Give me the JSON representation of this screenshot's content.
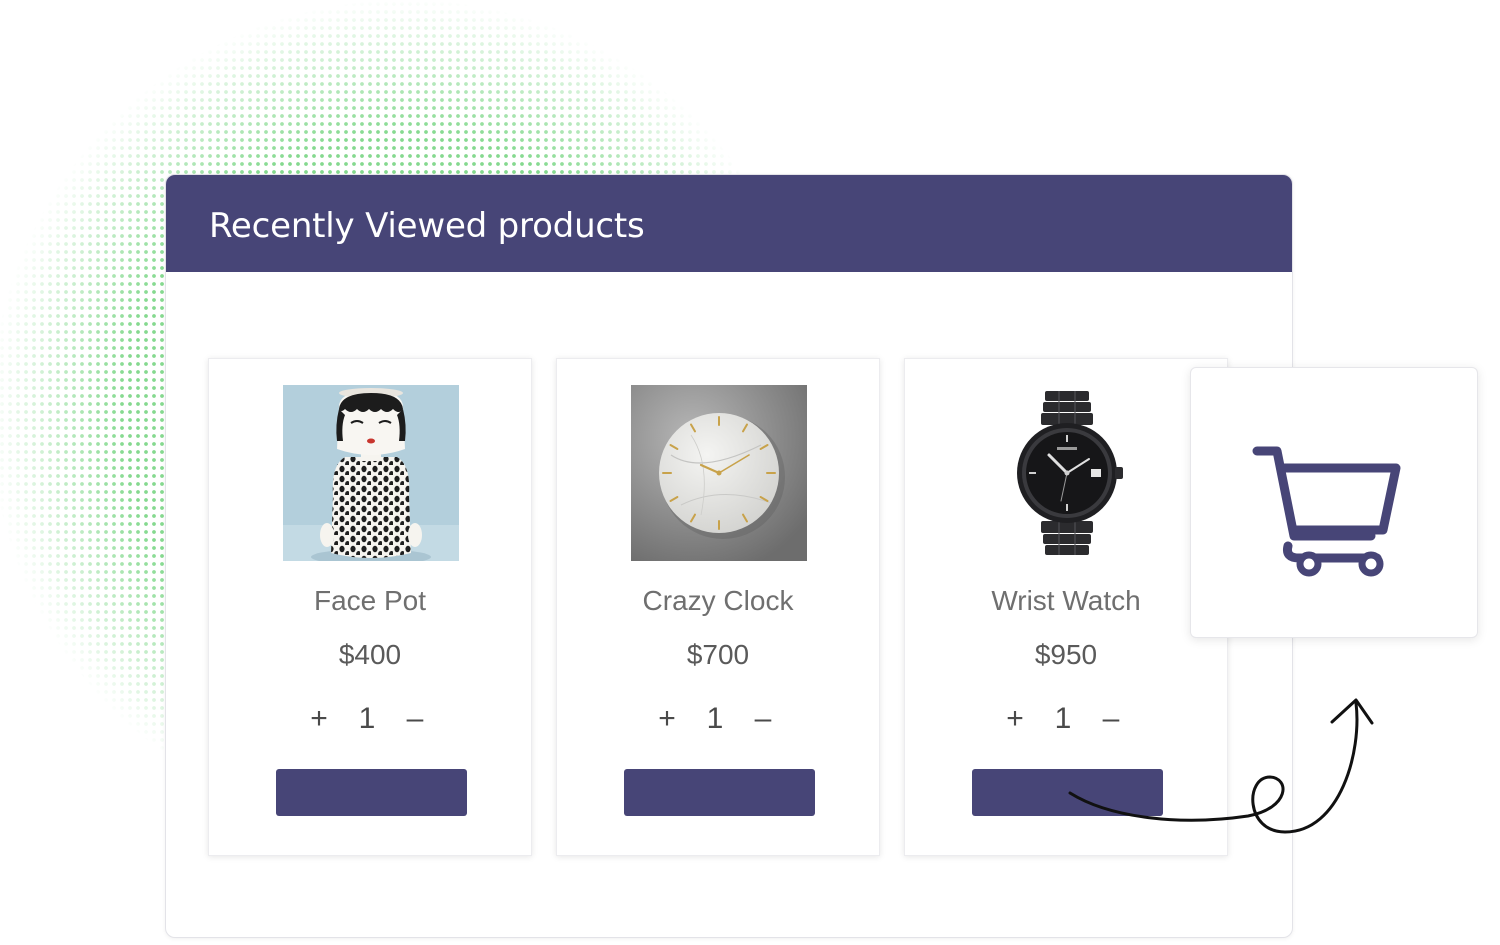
{
  "widget": {
    "title": "Recently Viewed products"
  },
  "products": [
    {
      "name": "Face Pot",
      "price": "$400",
      "quantity": "1",
      "plus": "+",
      "minus": "–",
      "image_icon": "face-pot-image"
    },
    {
      "name": "Crazy Clock",
      "price": "$700",
      "quantity": "1",
      "plus": "+",
      "minus": "–",
      "image_icon": "clock-image"
    },
    {
      "name": "Wrist Watch",
      "price": "$950",
      "quantity": "1",
      "plus": "+",
      "minus": "–",
      "image_icon": "wrist-watch-image"
    }
  ],
  "cart": {
    "icon": "shopping-cart-icon"
  },
  "colors": {
    "brand": "#474577",
    "dots": "#7fd88a"
  }
}
